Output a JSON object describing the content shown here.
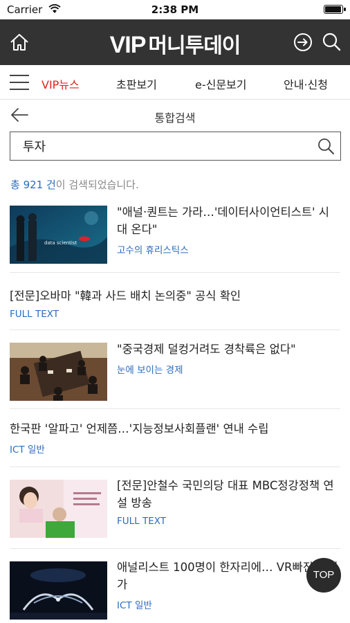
{
  "status_bar": {
    "carrier": "Carrier",
    "time": "2:38 PM",
    "battery_level": 1.0
  },
  "app_bar": {
    "logo_latin": "VIP",
    "logo_korean": "머니투데이",
    "background": "#333333",
    "icons": [
      "home-icon",
      "login-icon",
      "search-icon"
    ]
  },
  "nav": {
    "tabs": [
      {
        "label": "VIP뉴스",
        "active": true
      },
      {
        "label": "초판보기",
        "active": false
      },
      {
        "label": "e-신문보기",
        "active": false
      },
      {
        "label": "안내·신청",
        "active": false
      }
    ],
    "accent": "#e2231a"
  },
  "search": {
    "title": "통합검색",
    "query": "투자",
    "result_prefix": "총 921 건",
    "result_suffix": "이 검색되었습니다."
  },
  "results": [
    {
      "headline": "\"애널·퀀트는 가라…'데이터사이언티스트' 시대 온다\"",
      "section": "고수의 휴리스틱스",
      "thumb_caption": "data scientist"
    },
    {
      "headline": "[전문]오바마 \"韓과 사드 배치 논의중\" 공식 확인",
      "section": "FULL TEXT"
    },
    {
      "headline": "\"중국경제 덜컹거려도 경착륙은 없다\"",
      "section": "눈에 보이는 경제"
    },
    {
      "headline": "한국판 '알파고' 언제쯤…'지능정보사회플랜' 연내 수립",
      "section": "ICT 일반"
    },
    {
      "headline": "[전문]안철수 국민의당 대표 MBC정강정책 연설 방송",
      "section": "FULL TEXT"
    },
    {
      "headline": "애널리스트 100명이 한자리에… VR빠진 증권가",
      "section": "ICT 일반"
    }
  ],
  "top_button": "TOP",
  "link_color": "#2a6bbf"
}
